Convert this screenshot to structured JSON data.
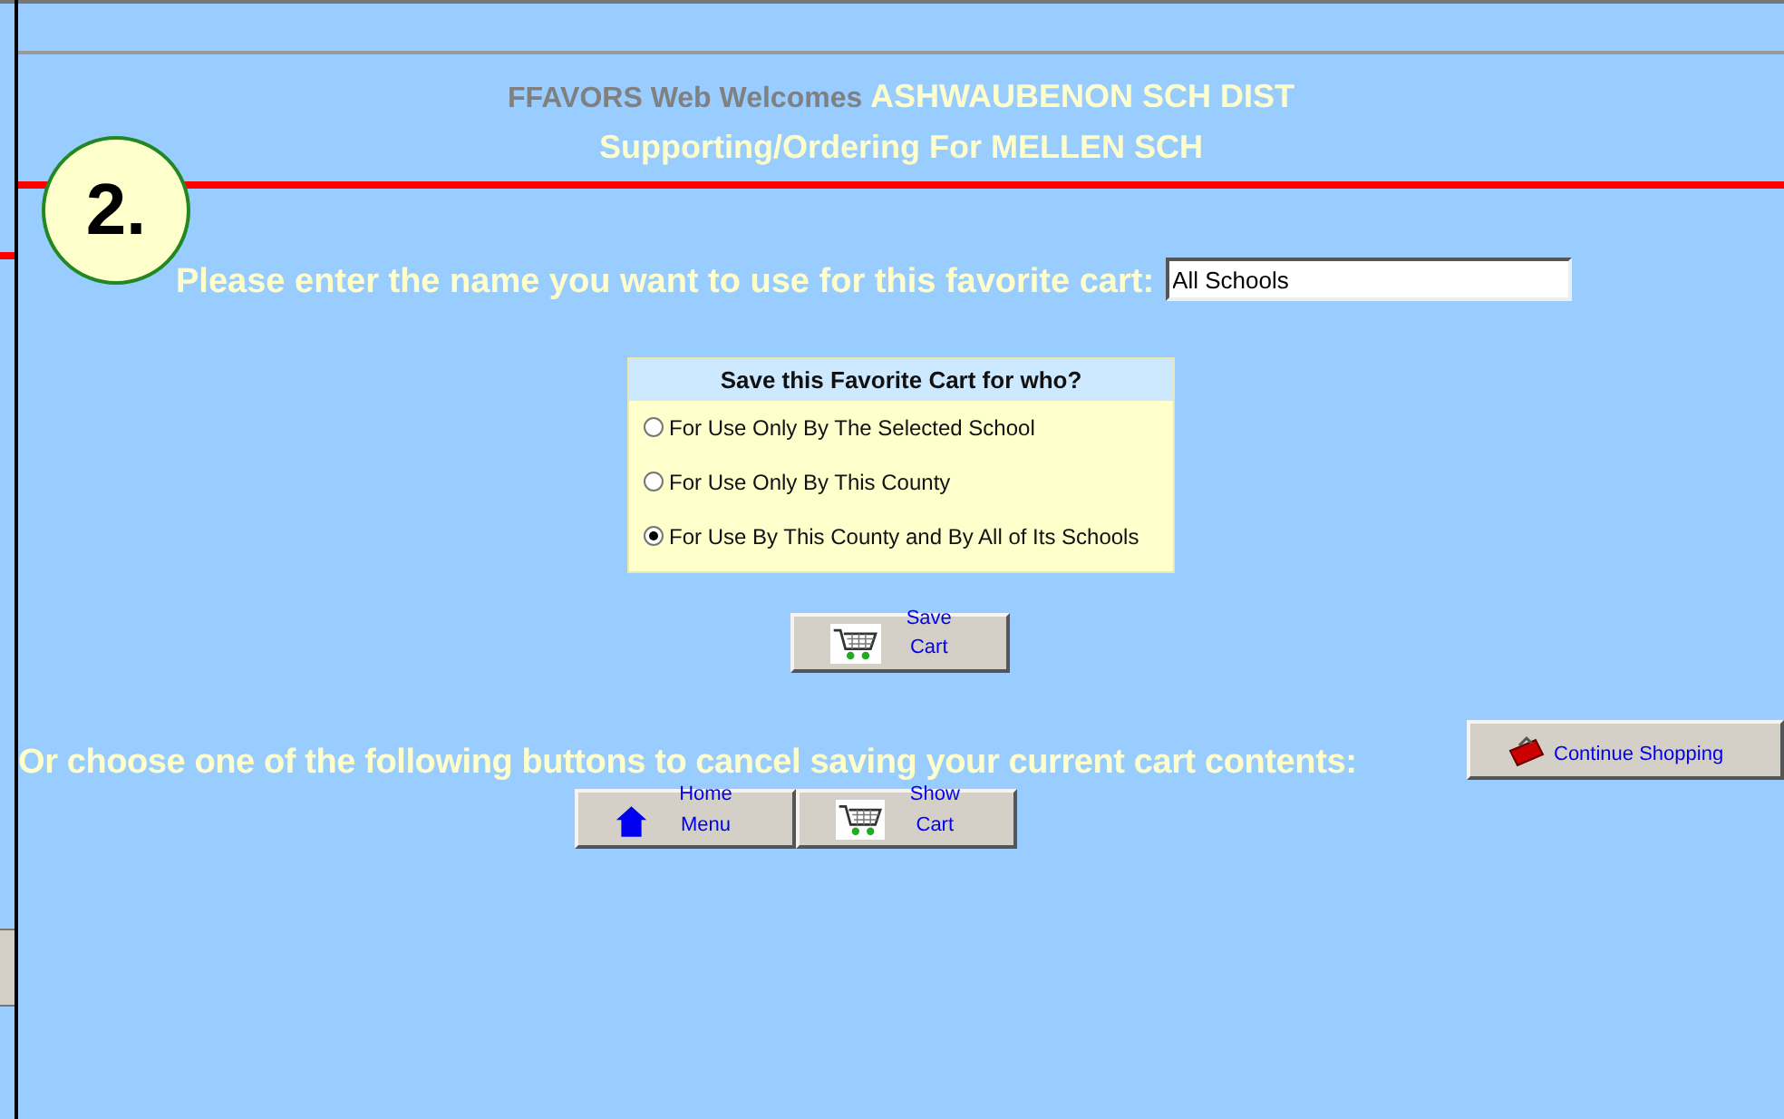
{
  "header": {
    "greeting": "FFAVORS Web Welcomes",
    "district": "ASHWAUBENON SCH DIST",
    "supporting": "Supporting/Ordering For MELLEN SCH"
  },
  "step_badge": "2.",
  "name_prompt": {
    "label": "Please enter the name you want to use for this favorite cart:",
    "value": "All Schools"
  },
  "save_for": {
    "title": "Save this Favorite Cart for who?",
    "options": [
      {
        "label": "For Use Only By The Selected School",
        "selected": false
      },
      {
        "label": "For Use Only By This County",
        "selected": false
      },
      {
        "label": "For Use By This County and By All of Its Schools",
        "selected": true
      }
    ]
  },
  "save_button": {
    "kind": "cart",
    "label": "Save Cart"
  },
  "cancel_prompt": "Or choose one of the following buttons to cancel saving your current cart contents:",
  "buttons": [
    {
      "kind": "continue",
      "label": "Continue Shopping"
    },
    {
      "kind": "home",
      "label": "Home Menu"
    },
    {
      "kind": "cart",
      "label": "Show Cart"
    }
  ]
}
